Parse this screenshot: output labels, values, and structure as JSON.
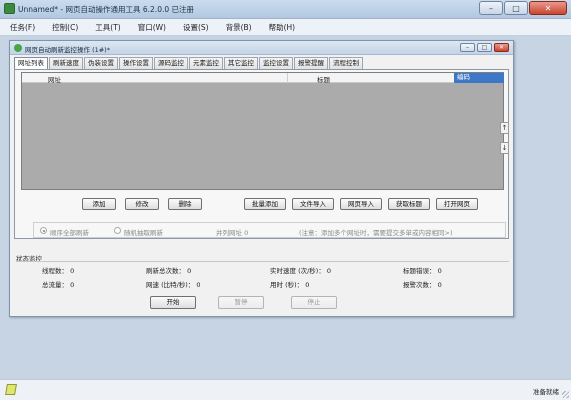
{
  "app": {
    "title": "Unnamed* - 网页自动操作通用工具 6.2.0.0  已注册",
    "minimize": "–",
    "maximize": "□",
    "close": "✕"
  },
  "menu": [
    "任务(F)",
    "控制(C)",
    "工具(T)",
    "窗口(W)",
    "设置(S)",
    "背景(B)",
    "帮助(H)"
  ],
  "child": {
    "title": "网页自动刷新监控操作 (1#)*",
    "minimize": "–",
    "maximize": "□",
    "close": "✕"
  },
  "tabs": [
    "网址列表",
    "刷新速度",
    "伪装设置",
    "操作设置",
    "源码监控",
    "元素监控",
    "其它监控",
    "监控设置",
    "报警提醒",
    "流程控制"
  ],
  "table": {
    "columns": {
      "url": "网址",
      "title": "标题",
      "encoding": "编码"
    },
    "scroll_up": "↑",
    "scroll_down": "↓"
  },
  "buttons": {
    "add": "添加",
    "edit": "修改",
    "delete": "删除",
    "batch_add": "批量添加",
    "import_file": "文件导入",
    "import_page": "网页导入",
    "fetch_title": "获取标题",
    "open_page": "打开网页"
  },
  "options": {
    "sequential": "顺序全部刷新",
    "random": "随机抽取刷新",
    "parallel": "并列网址   0",
    "hint": "(注意：添加多个网址时，需要提交多单或内容相同>)"
  },
  "status": {
    "header": "状态监控",
    "threads": "线程数：  0",
    "total_traffic": "总流量：  0",
    "refresh_total": "刷新总次数：  0",
    "speed": "网速 (比特/秒)：  0",
    "realtime_speed": "实时速度 (次/秒)：  0",
    "elapsed": "用时 (秒)：  0",
    "title_errors": "标题错误：  0",
    "alerts": "报警次数：  0"
  },
  "controls": {
    "start": "开始",
    "pause": "暂停",
    "stop": "停止"
  },
  "statusbar": {
    "ready": "准备就绪"
  }
}
